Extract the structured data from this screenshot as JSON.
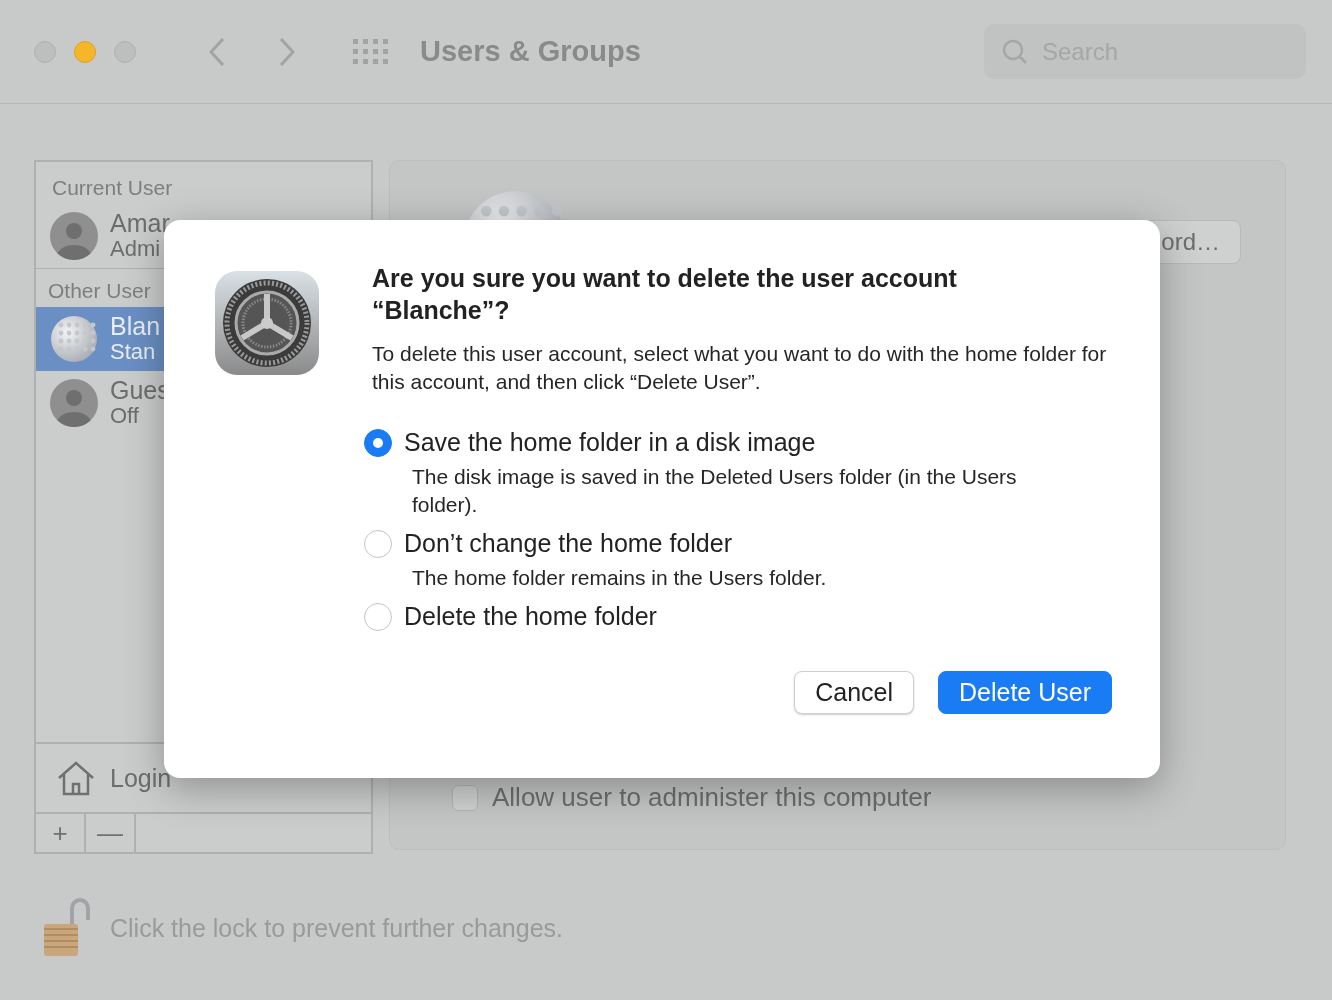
{
  "window": {
    "title": "Users & Groups",
    "search": {
      "placeholder": "Search"
    }
  },
  "sidebar": {
    "sections": [
      {
        "heading": "Current User",
        "users": [
          {
            "name": "Amar",
            "role": "Admi",
            "selected": false,
            "kind": "silhouette"
          }
        ]
      },
      {
        "heading": "Other User",
        "users": [
          {
            "name": "Blan",
            "role": "Stan",
            "selected": true,
            "kind": "golf-ball"
          },
          {
            "name": "Gues",
            "role": "Off",
            "selected": false,
            "kind": "silhouette"
          }
        ]
      }
    ],
    "login_options": "Login",
    "add_button": "+",
    "remove_button": "—"
  },
  "detail": {
    "reset_button": "ord…",
    "admin_checkbox": {
      "label": "Allow user to administer this computer",
      "checked": false
    }
  },
  "lock": {
    "text": "Click the lock to prevent further changes.",
    "locked": false
  },
  "dialog": {
    "title": "Are you sure you want to delete the user account “Blanche”?",
    "message": "To delete this user account, select what you want to do with the home folder for this account, and then click “Delete User”.",
    "options": [
      {
        "label": "Save the home folder in a disk image",
        "description": "The disk image is saved in the Deleted Users folder (in the Users folder).",
        "selected": true
      },
      {
        "label": "Don’t change the home folder",
        "description": "The home folder remains in the Users folder.",
        "selected": false
      },
      {
        "label": "Delete the home folder",
        "selected": false
      }
    ],
    "buttons": [
      {
        "label": "Cancel",
        "kind": "secondary"
      },
      {
        "label": "Delete User",
        "kind": "default"
      }
    ]
  }
}
